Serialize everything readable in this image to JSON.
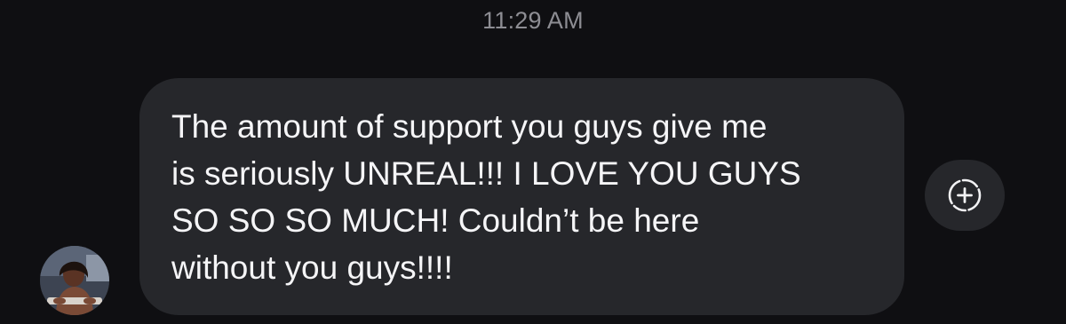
{
  "conversation": {
    "timestamp": "11:29 AM"
  },
  "message": {
    "text": "The amount of support you guys give me\nis seriously UNREAL!!! I LOVE YOU GUYS\nSO SO SO MUCH! Couldn’t be here\nwithout you guys!!!!",
    "avatar_icon": "sender-avatar",
    "reaction_icon": "add-reaction-icon"
  },
  "colors": {
    "background": "#0f0f12",
    "bubble": "#26272b",
    "message_text": "#f5f5f7",
    "timestamp_text": "#8d8d93"
  }
}
